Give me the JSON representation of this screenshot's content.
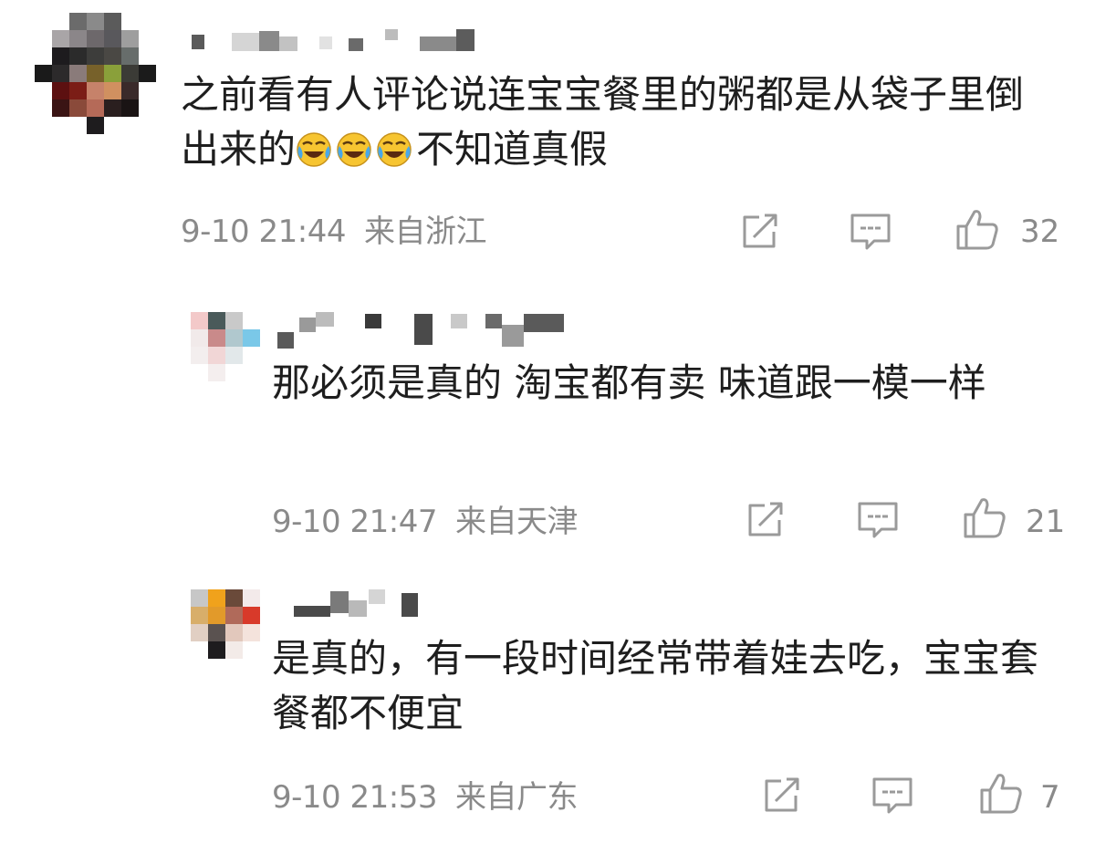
{
  "comments": [
    {
      "text_before_emoji": "之前看有人评论说连宝宝餐里的粥都是从袋子里倒出来的",
      "emoji_name": "laugh-cry-emoji",
      "emoji_count": 3,
      "text_after_emoji": "不知道真假",
      "date": "9-10",
      "time": "21:44",
      "location": "来自浙江",
      "likes": "32"
    },
    {
      "text": "那必须是真的 淘宝都有卖 味道跟一模一样",
      "date": "9-10",
      "time": "21:47",
      "location": "来自天津",
      "likes": "21"
    },
    {
      "text": "是真的，有一段时间经常带着娃去吃，宝宝套餐都不便宜",
      "date": "9-10",
      "time": "21:53",
      "location": "来自广东",
      "likes": "7"
    }
  ],
  "icons": {
    "share": "share-icon",
    "reply": "comment-icon",
    "like": "thumbs-up-icon"
  },
  "colors": {
    "text": "#1e1e1e",
    "meta": "#8a8a8a",
    "icon": "#9a9a9a",
    "emoji_face": "#f7c531"
  }
}
